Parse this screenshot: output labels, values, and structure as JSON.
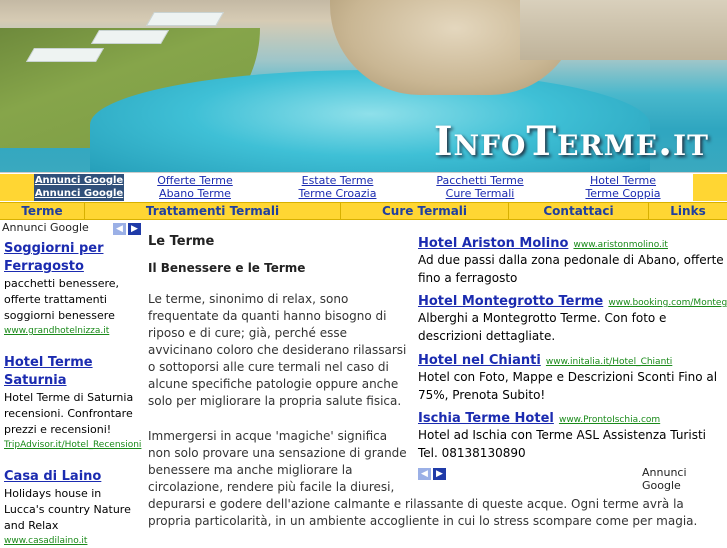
{
  "site": {
    "title": "InfoTerme.it"
  },
  "ads_bar": {
    "label1": "Annunci Google",
    "label2": "Annunci Google",
    "links": [
      [
        "Offerte Terme",
        "Abano Terme"
      ],
      [
        "Estate Terme",
        "Terme Croazia"
      ],
      [
        "Pacchetti Terme",
        "Cure Termali"
      ],
      [
        "Hotel Terme",
        "Terme Coppia"
      ]
    ]
  },
  "nav": {
    "items": [
      "Terme",
      "Trattamenti Termali",
      "Cure Termali",
      "Contattaci",
      "Links"
    ]
  },
  "google_label": "Annunci Google",
  "left_ads": [
    {
      "title": "Soggiorni per Ferragosto",
      "desc": "pacchetti benessere, offerte trattamenti soggiorni benessere",
      "url": "www.grandhotelnizza.it"
    },
    {
      "title": "Hotel Terme Saturnia",
      "desc": "Hotel Terme di Saturnia recensioni. Confrontare prezzi e recensioni!",
      "url": "TripAdvisor.it/Hotel_Recensioni"
    },
    {
      "title": "Casa di Laino",
      "desc": "Holidays house in Lucca's country Nature and Relax",
      "url": "www.casadilaino.it"
    }
  ],
  "main": {
    "heading": "Le Terme",
    "subheading": "Il Benessere e le Terme",
    "p1": "Le terme, sinonimo di relax, sono frequentate da quanti hanno bisogno di riposo e di cure; già, perché esse avvicinano coloro che desiderano rilassarsi o sottoporsi alle cure termali nel caso di alcune specifiche patologie oppure anche solo per migliorare la propria salute fisica.",
    "p2": "Immergersi in acque 'magiche' significa non solo provare una sensazione di grande benessere ma anche migliorare la circolazione, rendere più facile la diuresi,",
    "p2_tail": "depurarsi e godere dell'azione calmante e rilassante di queste acque. Ogni terme avrà la propria particolarità, in un ambiente accogliente in cui lo stress scompare come per magia."
  },
  "right_ads": [
    {
      "title": "Hotel Ariston Molino",
      "url": "www.aristonmolino.it",
      "desc": "Ad due passi dalla zona pedonale di Abano, offerte fino a ferragosto"
    },
    {
      "title": "Hotel Montegrotto Terme",
      "url": "www.booking.com/Montegrotto-Te",
      "desc": "Alberghi a Montegrotto Terme. Con foto e descrizioni dettagliate."
    },
    {
      "title": "Hotel nel Chianti",
      "url": "www.initalia.it/Hotel_Chianti",
      "desc": "Hotel con Foto, Mappe e Descrizioni Sconti Fino al 75%, Prenota Subito!"
    },
    {
      "title": "Ischia Terme Hotel",
      "url": "www.ProntoIschia.com",
      "desc": "Hotel ad Ischia con Terme ASL Assistenza Turisti Tel. 08138130890"
    }
  ]
}
